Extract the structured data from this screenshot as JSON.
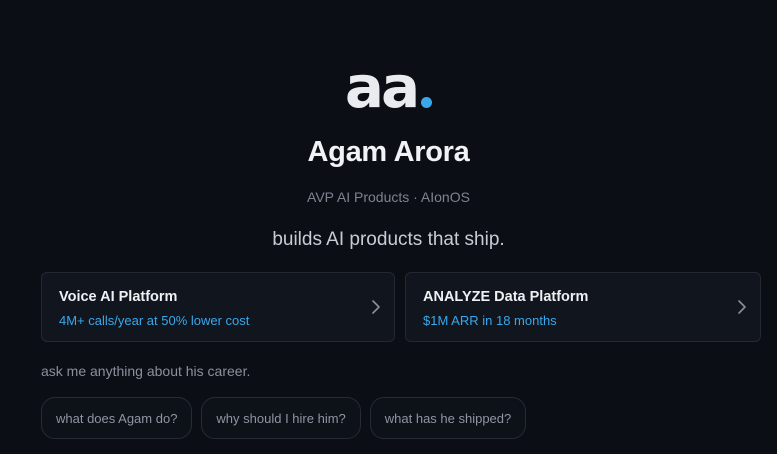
{
  "logo": {
    "text": "aa",
    "accent_color": "#38a8ec"
  },
  "profile": {
    "name": "Agam Arora",
    "role": "AVP AI Products · AIonOS",
    "tagline": "builds AI products that ship."
  },
  "cards": [
    {
      "title": "Voice AI Platform",
      "subtitle": "4M+ calls/year at 50% lower cost",
      "icon": "chevron-right-icon"
    },
    {
      "title": "ANALYZE Data Platform",
      "subtitle": "$1M ARR in 18 months",
      "icon": "chevron-right-icon"
    }
  ],
  "colors": {
    "accent": "#38a8ec",
    "background": "#0b0e14"
  },
  "chat": {
    "prompt": "ask me anything about his career.",
    "suggestions": [
      "what does Agam do?",
      "why should I hire him?",
      "what has he shipped?"
    ]
  }
}
